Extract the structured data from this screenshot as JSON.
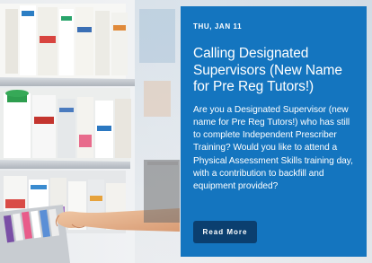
{
  "card": {
    "date": "THU, JAN 11",
    "headline": "Calling Designated Supervisors (New Name for Pre Reg Tutors!)",
    "body": "Are you a Designated Supervisor (new name for Pre Reg Tutors!) who has still to complete Independent Prescriber Training? Would you like to attend a Physical Assessment Skills training day, with a contribution to backfill and equipment provided?",
    "button_label": "Read More"
  },
  "colors": {
    "panel": "#1475bf",
    "button": "#0b3f6f",
    "text": "#ffffff"
  },
  "photo": {
    "subject": "pharmacy-shelves-hand-photo"
  }
}
